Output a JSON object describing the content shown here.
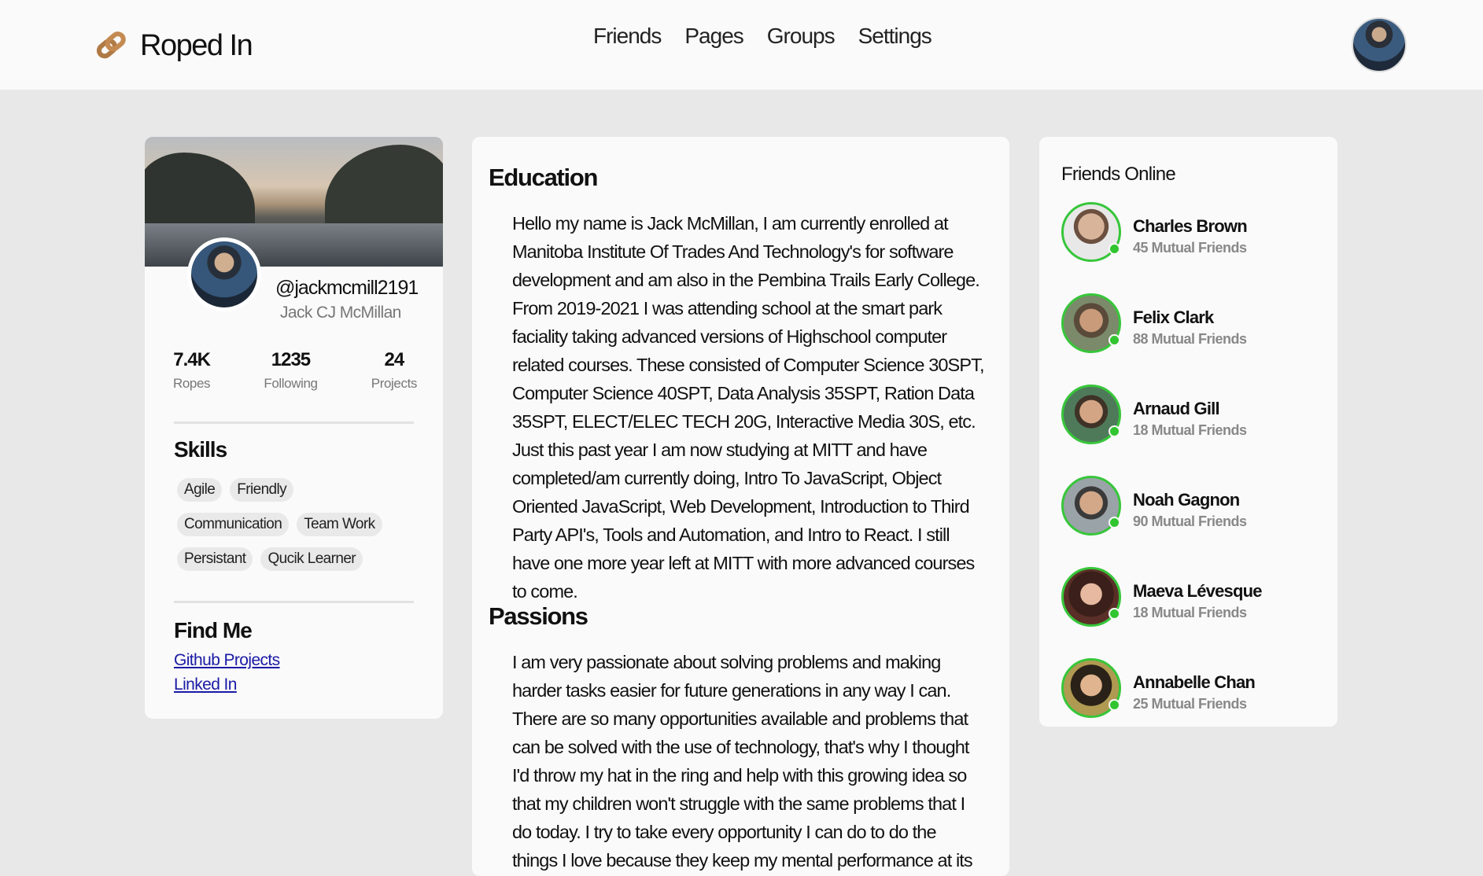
{
  "header": {
    "brand": "Roped In",
    "nav": [
      "Friends",
      "Pages",
      "Groups",
      "Settings"
    ]
  },
  "profile": {
    "handle": "@jackmcmill2191",
    "full_name": "Jack CJ McMillan",
    "stats": [
      {
        "value": "7.4K",
        "label": "Ropes"
      },
      {
        "value": "1235",
        "label": "Following"
      },
      {
        "value": "24",
        "label": "Projects"
      }
    ],
    "skills_title": "Skills",
    "skills": [
      "Agile",
      "Friendly",
      "Communication",
      "Team Work",
      "Persistant",
      "Qucik Learner"
    ],
    "find_title": "Find Me",
    "links": [
      "Github Projects",
      "Linked In"
    ]
  },
  "content": {
    "education_title": "Education",
    "education_text": "Hello my name is Jack McMillan, I am currently enrolled at Manitoba Institute Of Trades And Technology's for software development and am also in the Pembina Trails Early College. From 2019-2021 I was attending school at the smart park faciality taking advanced versions of Highschool computer related courses. These consisted of Computer Science 30SPT, Computer Science 40SPT, Data Analysis 35SPT, Ration Data 35SPT, ELECT/ELEC TECH 20G, Interactive Media 30S, etc. Just this past year I am now studying at MITT and have completed/am currently doing, Intro To JavaScript, Object Oriented JavaScript, Web Development, Introduction to Third Party API's, Tools and Automation, and Intro to React. I still have one more year left at MITT with more advanced courses to come.",
    "passions_title": "Passions",
    "passions_text": "I am very passionate about solving problems and making harder tasks easier for future generations in any way I can. There are so many opportunities available and problems that can be solved with the use of technology, that's why I thought I'd throw my hat in the ring and help with this growing idea so that my children won't struggle with the same problems that I do today. I try to take every opportunity I can do to do the things I love because they keep my mental performance at its peak. Some of my hobbies are"
  },
  "friends_online": {
    "title": "Friends Online",
    "items": [
      {
        "name": "Charles Brown",
        "mutual": "45 Mutual Friends"
      },
      {
        "name": "Felix Clark",
        "mutual": "88 Mutual Friends"
      },
      {
        "name": "Arnaud Gill",
        "mutual": "18 Mutual Friends"
      },
      {
        "name": "Noah Gagnon",
        "mutual": "90 Mutual Friends"
      },
      {
        "name": "Maeva Lévesque",
        "mutual": "18 Mutual Friends"
      },
      {
        "name": "Annabelle Chan",
        "mutual": "25 Mutual Friends"
      }
    ]
  },
  "colors": {
    "background": "#e8e8e8",
    "card": "#fafafa",
    "online": "#37c63a",
    "link": "#1a1aa6",
    "logo": "#b07a45"
  }
}
